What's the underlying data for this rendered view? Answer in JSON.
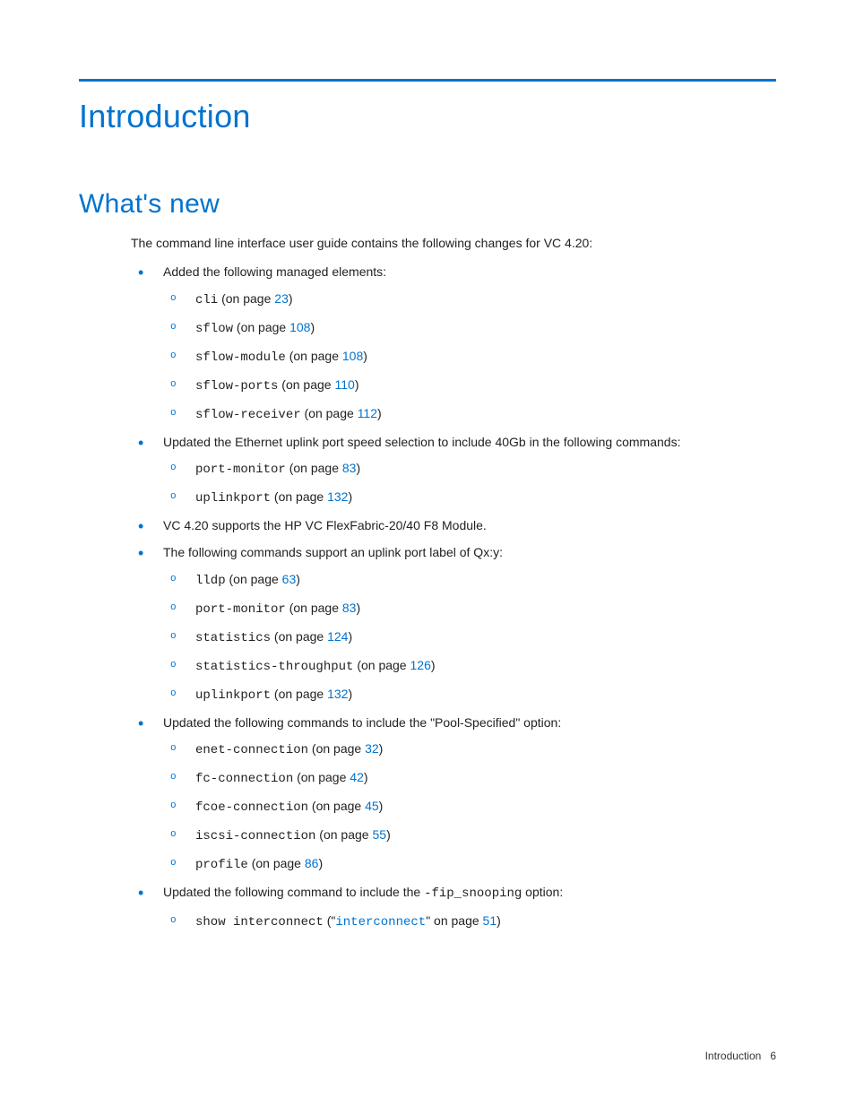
{
  "heading1": "Introduction",
  "heading2": "What's new",
  "intro": "The command line interface user guide contains the following changes for VC 4.20:",
  "items": [
    {
      "text": "Added the following managed elements:",
      "sub": [
        {
          "code": "cli",
          "on_page": " (on page ",
          "page": "23",
          "after": ")"
        },
        {
          "code": "sflow",
          "on_page": " (on page ",
          "page": "108",
          "after": ")"
        },
        {
          "code": "sflow-module",
          "on_page": " (on page ",
          "page": "108",
          "after": ")"
        },
        {
          "code": "sflow-ports",
          "on_page": " (on page ",
          "page": "110",
          "after": ")"
        },
        {
          "code": "sflow-receiver",
          "on_page": " (on page ",
          "page": "112",
          "after": ")"
        }
      ]
    },
    {
      "text": "Updated the Ethernet uplink port speed selection to include 40Gb in the following commands:",
      "sub": [
        {
          "code": "port-monitor",
          "on_page": " (on page ",
          "page": "83",
          "after": ")"
        },
        {
          "code": "uplinkport",
          "on_page": " (on page ",
          "page": "132",
          "after": ")"
        }
      ]
    },
    {
      "text": "VC 4.20 supports the HP VC FlexFabric-20/40 F8 Module."
    },
    {
      "text": "The following commands support an uplink port label of Qx:y:",
      "sub": [
        {
          "code": "lldp",
          "on_page": " (on page ",
          "page": "63",
          "after": ")"
        },
        {
          "code": "port-monitor",
          "on_page": " (on page ",
          "page": "83",
          "after": ")"
        },
        {
          "code": "statistics",
          "on_page": " (on page ",
          "page": "124",
          "after": ")"
        },
        {
          "code": "statistics-throughput",
          "on_page": " (on page ",
          "page": "126",
          "after": ")"
        },
        {
          "code": "uplinkport",
          "on_page": " (on page ",
          "page": "132",
          "after": ")"
        }
      ]
    },
    {
      "text": "Updated the following commands to include the \"Pool-Specified\" option:",
      "sub": [
        {
          "code": "enet-connection",
          "on_page": " (on page ",
          "page": "32",
          "after": ")"
        },
        {
          "code": "fc-connection",
          "on_page": " (on page ",
          "page": "42",
          "after": ")"
        },
        {
          "code": "fcoe-connection",
          "on_page": " (on page ",
          "page": "45",
          "after": ")"
        },
        {
          "code": "iscsi-connection",
          "on_page": " (on page ",
          "page": "55",
          "after": ")"
        },
        {
          "code": "profile",
          "on_page": " (on page ",
          "page": "86",
          "after": ")"
        }
      ]
    },
    {
      "text_pre": "Updated the following command to include the ",
      "text_code": "-fip_snooping",
      "text_post": " option:",
      "sub": [
        {
          "code": "show interconnect",
          "paren_pre": " (\"",
          "xref": "interconnect",
          "paren_mid": "\" on page ",
          "page": "51",
          "after": ")"
        }
      ]
    }
  ],
  "footer_label": "Introduction",
  "footer_page": "6"
}
